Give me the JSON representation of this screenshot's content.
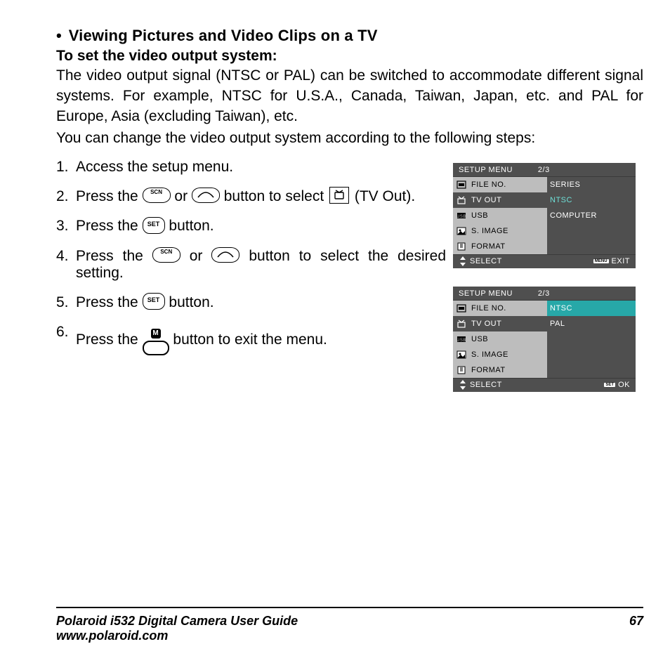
{
  "heading": "Viewing Pictures and Video Clips on a TV",
  "subheading": "To set the video output system:",
  "intro1": "The video output signal (NTSC or PAL) can be switched to accommodate different signal systems. For example, NTSC for U.S.A., Canada, Taiwan, Japan, etc. and PAL for Europe, Asia (excluding Taiwan), etc.",
  "intro2": "You can change the video output system according to the following steps:",
  "steps": {
    "s1": "Access the setup menu.",
    "s2a": "Press the ",
    "s2b": " or ",
    "s2c": " button to select ",
    "s2d": " (TV Out).",
    "s3a": "Press the ",
    "s3b": " button.",
    "s4a": "Press the ",
    "s4b": " or ",
    "s4c": " button to select the desired setting.",
    "s5a": "Press the ",
    "s5b": " button.",
    "s6a": "Press the ",
    "s6b": " button to exit the menu."
  },
  "menu_common": {
    "title": "SETUP MENU",
    "page": "2/3",
    "labels": [
      "FILE NO.",
      "TV OUT",
      "USB",
      "S. IMAGE",
      "FORMAT"
    ],
    "select": "SELECT"
  },
  "menu1": {
    "values": [
      "SERIES",
      "NTSC",
      "COMPUTER",
      "",
      ""
    ],
    "selected_label_index": 1,
    "teal_value_index": 1,
    "footer_right": "EXIT",
    "footer_chip": "MENU"
  },
  "menu2": {
    "values": [
      "NTSC",
      "PAL",
      "",
      "",
      ""
    ],
    "selected_label_index": 1,
    "selected_value_index": 0,
    "footer_right": "OK",
    "footer_chip": "SET"
  },
  "footer": {
    "guide": "Polaroid i532 Digital Camera User Guide",
    "site": "www.polaroid.com",
    "page_number": "67"
  }
}
